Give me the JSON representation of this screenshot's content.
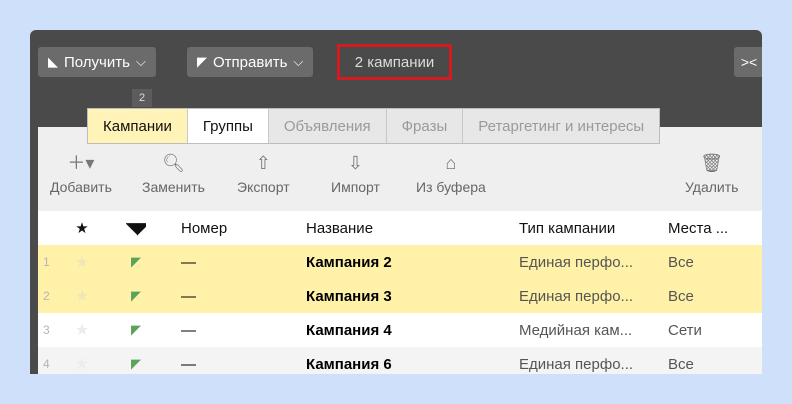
{
  "toolbar_top": {
    "receive_label": "Получить",
    "send_label": "Отправить",
    "count_label": "2 кампании",
    "badge": "2"
  },
  "tabs": [
    {
      "label": "Кампании"
    },
    {
      "label": "Группы"
    },
    {
      "label": "Объявления"
    },
    {
      "label": "Фразы"
    },
    {
      "label": "Ретаргетинг и интересы"
    }
  ],
  "actions": {
    "add": "Добавить",
    "replace": "Заменить",
    "export": "Экспорт",
    "import": "Импорт",
    "paste": "Из буфера",
    "delete": "Удалить"
  },
  "table": {
    "columns": {
      "number": "Номер",
      "name": "Название",
      "type": "Тип кампании",
      "places": "Места ..."
    },
    "rows": [
      {
        "idx": "1",
        "number": "—",
        "name": "Кампания 2",
        "type": "Единая перфо...",
        "places": "Все"
      },
      {
        "idx": "2",
        "number": "—",
        "name": "Кампания 3",
        "type": "Единая перфо...",
        "places": "Все"
      },
      {
        "idx": "3",
        "number": "—",
        "name": "Кампания 4",
        "type": "Медийная кам...",
        "places": "Сети"
      },
      {
        "idx": "4",
        "number": "—",
        "name": "Кампания 6",
        "type": "Единая перфо...",
        "places": "Все"
      }
    ]
  },
  "colors": {
    "highlight": "#d41b21",
    "selected_row": "#fff2a8",
    "active_tab": "#fff3b8",
    "arrow_green": "#5aa35a"
  }
}
